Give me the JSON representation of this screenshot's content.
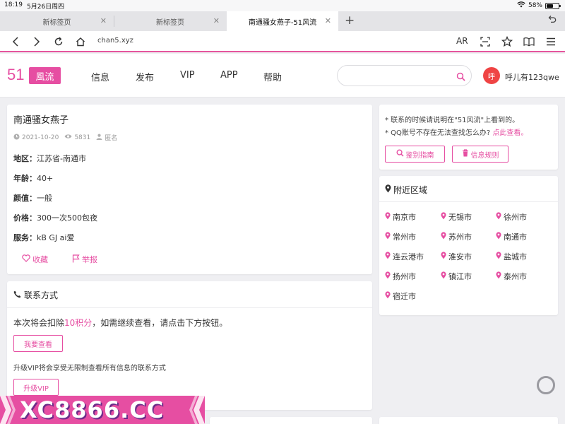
{
  "status_bar": {
    "time": "18:19",
    "date": "5月26日周四",
    "battery": "58%",
    "battery_level": 0.58
  },
  "tabs": [
    {
      "label": "新标签页",
      "active": false
    },
    {
      "label": "新标签页",
      "active": false
    },
    {
      "label": "南通骚女燕子-51风流",
      "active": true
    }
  ],
  "address_bar": {
    "url": "chan5.xyz",
    "ar_label": "AR"
  },
  "header": {
    "logo_number": "51",
    "logo_text": "風流",
    "nav": [
      "信息",
      "发布",
      "VIP",
      "APP",
      "帮助"
    ],
    "search_placeholder": "",
    "user_avatar_char": "呼",
    "username": "呼儿有123qwe"
  },
  "detail": {
    "title": "南通骚女燕子",
    "date": "2021-10-20",
    "views": "5831",
    "author": "匿名",
    "fields": [
      {
        "key": "地区：",
        "value": "江苏省-南通市"
      },
      {
        "key": "年龄：",
        "value": "40+"
      },
      {
        "key": "颜值：",
        "value": "一般"
      },
      {
        "key": "价格：",
        "value": "300一次500包夜"
      },
      {
        "key": "服务：",
        "value": "kB GJ ai爱"
      }
    ],
    "favorite_label": "收藏",
    "report_label": "举报"
  },
  "contact": {
    "title": "联系方式",
    "msg_before": "本次将会扣除",
    "msg_points": "10积分",
    "msg_after": "，如需继续查看，请点击下方按钮。",
    "view_button": "我要查看",
    "vip_note": "升级VIP将会享受无限制查看所有信息的联系方式",
    "vip_button": "升级VIP"
  },
  "notice": {
    "line1": "* 联系的时候请说明在\"51风流\"上看到的。",
    "line2": "* QQ账号不存在无法查找怎么办?",
    "line2_link": "点此查看。",
    "guide_button": "鉴别指南",
    "rules_button": "信息规则"
  },
  "nearby": {
    "title": "附近区域",
    "cities": [
      "南京市",
      "无锡市",
      "徐州市",
      "常州市",
      "苏州市",
      "南通市",
      "连云港市",
      "淮安市",
      "盐城市",
      "扬州市",
      "镇江市",
      "泰州市",
      "宿迁市"
    ]
  },
  "banner": {
    "text": "XC8866.CC"
  },
  "colors": {
    "accent": "#e64ea2",
    "avatar": "#ef4444"
  }
}
